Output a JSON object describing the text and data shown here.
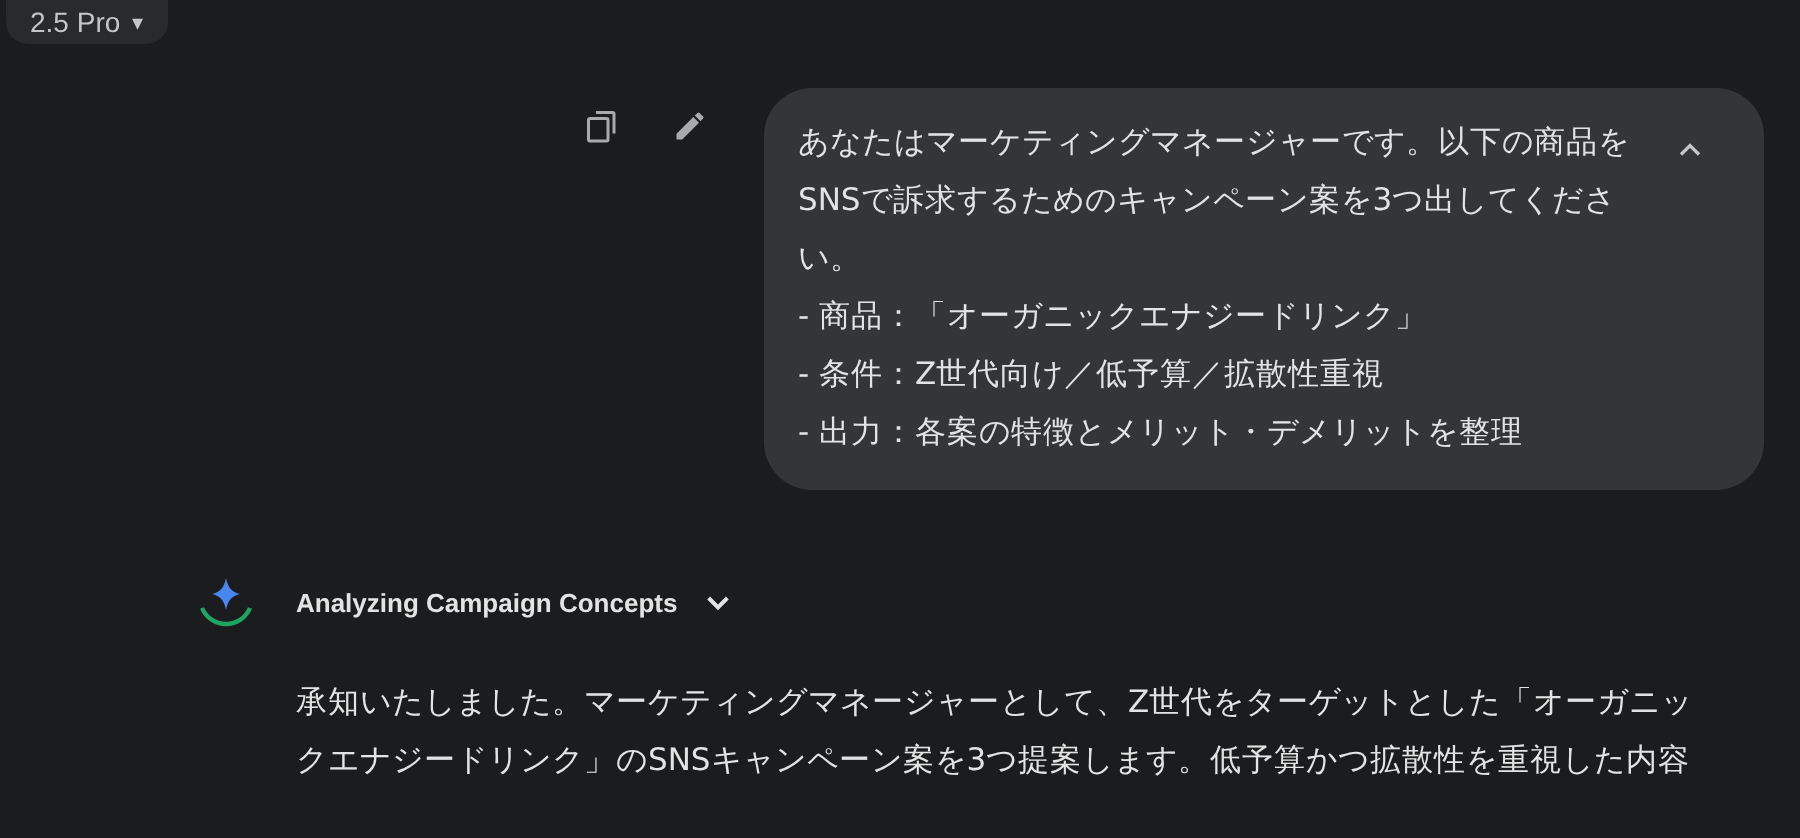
{
  "model_picker": {
    "label": "2.5 Pro",
    "caret": "▾"
  },
  "user_message": {
    "lines": [
      "あなたはマーケティングマネージャーです。以下の商品をSNSで訴求するためのキャンペーン案を3つ出してください。",
      "- 商品：「オーガニックエナジードリンク」",
      "- 条件：Z世代向け／低予算／拡散性重視",
      "- 出力：各案の特徴とメリット・デメリットを整理"
    ],
    "expanded": true
  },
  "response": {
    "thinking_title": "Analyzing Campaign Concepts",
    "thinking_expanded": false,
    "text": "承知いたしました。マーケティングマネージャーとして、Z世代をターゲットとした「オーガニックエナジードリンク」のSNSキャンペーン案を3つ提案します。低予算かつ拡散性を重視した内容"
  }
}
